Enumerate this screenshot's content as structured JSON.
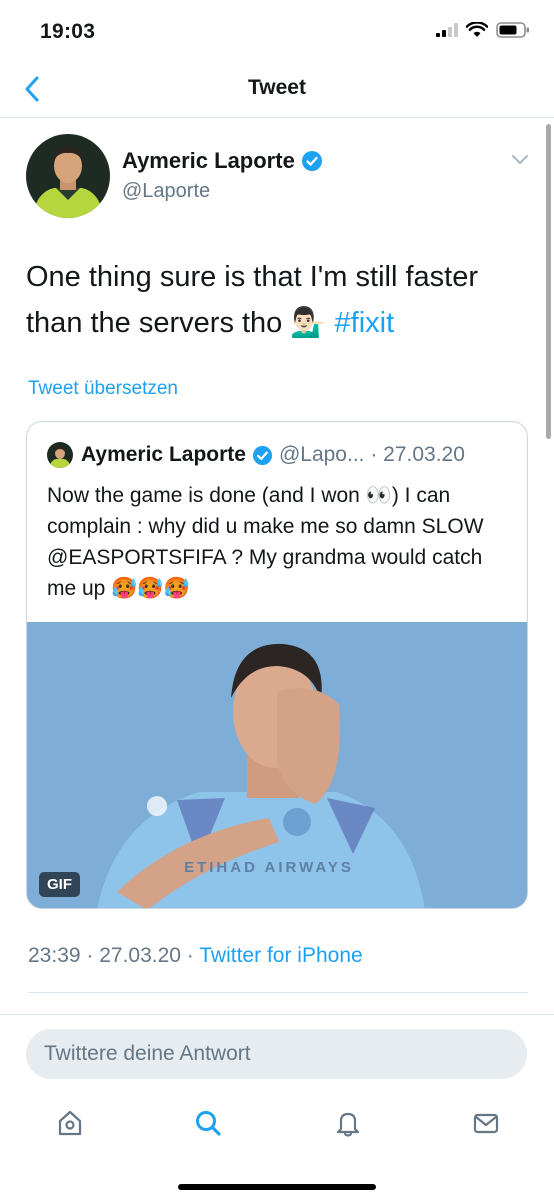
{
  "status": {
    "time": "19:03"
  },
  "nav": {
    "title": "Tweet"
  },
  "author": {
    "name": "Aymeric Laporte",
    "handle": "@Laporte"
  },
  "tweet": {
    "text": "One thing sure is that I'm still faster than the servers tho 💁🏻‍♂️",
    "hashtag": "#fixit",
    "translate": "Tweet übersetzen",
    "timestamp": "23:39 · 27.03.20 ·",
    "source": "Twitter for iPhone"
  },
  "quoted": {
    "name": "Aymeric Laporte",
    "handle_date": "@Lapo... · 27.03.20",
    "text": "Now the game is done (and I won 👀) I can complain : why did u make me so damn SLOW @EASPORTSFIFA ? My grandma would catch me up 🥵🥵🥵",
    "media_badge": "GIF",
    "kit_text": "ETIHAD AIRWAYS"
  },
  "reply": {
    "placeholder": "Twittere deine Antwort"
  },
  "tabs": [
    "home-icon",
    "search-icon",
    "notifications-icon",
    "messages-icon"
  ],
  "colors": {
    "accent": "#1da1f2",
    "secondary_text": "#657786",
    "divider": "#e1e8ed"
  }
}
